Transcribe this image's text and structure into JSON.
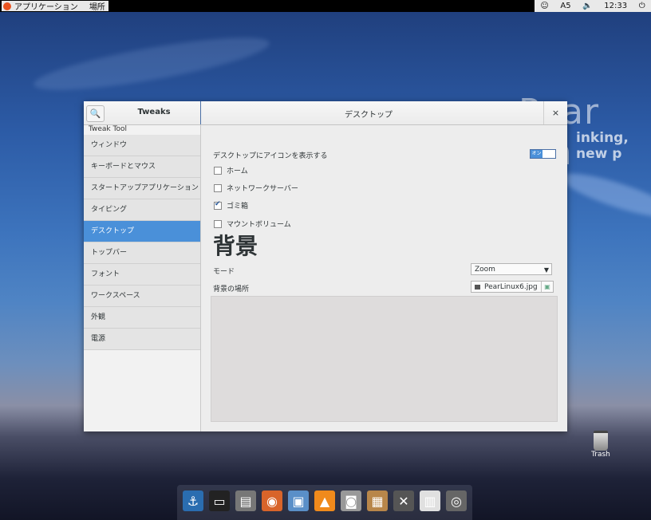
{
  "topbar": {
    "applications_label": "アプリケーション",
    "places_label": "場所",
    "keyboard_indicator": "A5",
    "clock": "12:33"
  },
  "wallpaper": {
    "title": "Pear Lin",
    "subtitle": "inking, new p"
  },
  "window": {
    "sidebar_title": "Tweaks",
    "page_title": "デスクトップ",
    "close_glyph": "×",
    "search_glyph": "🔍",
    "sidebar_heading": "Tweak Tool",
    "sidebar_items": [
      {
        "label": "ウィンドウ"
      },
      {
        "label": "キーボードとマウス"
      },
      {
        "label": "スタートアップアプリケーション"
      },
      {
        "label": "タイピング"
      },
      {
        "label": "デスクトップ"
      },
      {
        "label": "トップバー"
      },
      {
        "label": "フォント"
      },
      {
        "label": "ワークスペース"
      },
      {
        "label": "外観"
      },
      {
        "label": "電源"
      }
    ],
    "active_index": 4
  },
  "desktop": {
    "show_icons_label": "デスクトップにアイコンを表示する",
    "toggle_label": "オン",
    "toggle_on": true,
    "checkboxes": [
      {
        "label": "ホーム",
        "checked": false
      },
      {
        "label": "ネットワークサーバー",
        "checked": false
      },
      {
        "label": "ゴミ箱",
        "checked": true
      },
      {
        "label": "マウントボリューム",
        "checked": false
      }
    ],
    "background_heading": "背景",
    "mode_label": "モード",
    "mode_value": "Zoom",
    "location_label": "背景の場所",
    "location_value": "PearLinux6.jpg"
  },
  "desktop_icons": {
    "trash_label": "Trash"
  },
  "dock": {
    "icons": [
      "anchor-icon",
      "terminal-icon",
      "files-icon",
      "firefox-icon",
      "photo-icon",
      "vlc-icon",
      "camera-icon",
      "package-installer-icon",
      "tools-icon",
      "settings-icon",
      "trash-icon"
    ]
  },
  "colors": {
    "accent": "#4a90d9",
    "topbar_bg": "#000000"
  }
}
